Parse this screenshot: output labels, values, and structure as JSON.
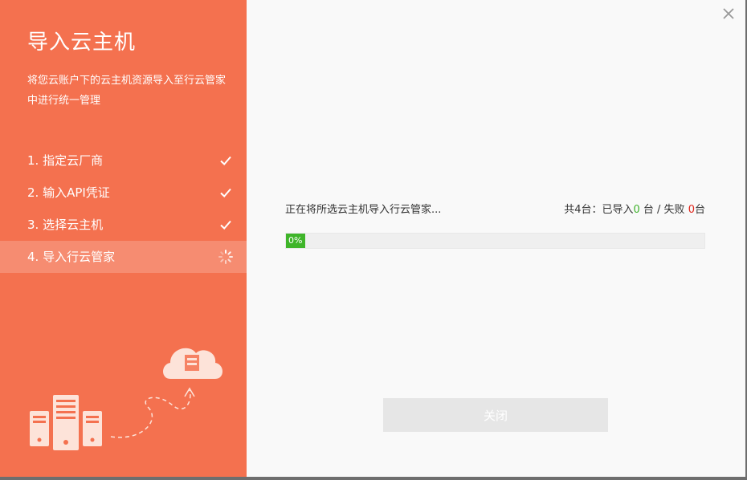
{
  "sidebar": {
    "title": "导入云主机",
    "description": "将您云账户下的云主机资源导入至行云管家中进行统一管理",
    "steps": [
      {
        "label": "1. 指定云厂商",
        "status": "done"
      },
      {
        "label": "2. 输入API凭证",
        "status": "done"
      },
      {
        "label": "3. 选择云主机",
        "status": "done"
      },
      {
        "label": "4. 导入行云管家",
        "status": "in-progress"
      }
    ]
  },
  "main": {
    "status_text": "正在将所选云主机导入行云管家...",
    "summary": {
      "prefix": "共4台：已导入",
      "imported": "0",
      "middle": " 台 / 失败 ",
      "failed": "0",
      "suffix": "台"
    },
    "progress": {
      "label": "0%",
      "value": 0
    },
    "close_button_label": "关闭"
  },
  "colors": {
    "accent": "#f4714f",
    "active_step": "#f68c71",
    "progress": "#3fb52a",
    "imported_count": "#3fb22b",
    "failed_count": "#e0241a"
  },
  "icons": {
    "close": "close-icon",
    "step_done": "check-icon",
    "step_running": "spinner-icon"
  }
}
